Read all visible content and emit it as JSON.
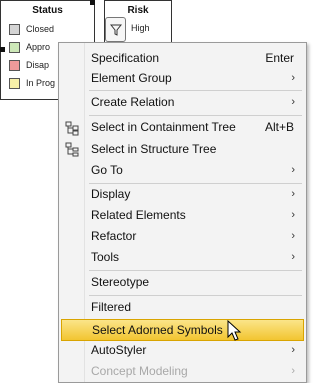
{
  "legend_status": {
    "title": "Status",
    "items": [
      {
        "label": "Closed",
        "color": "#d4d4d4"
      },
      {
        "label": "Appro",
        "color": "#cde8b8"
      },
      {
        "label": "Disap",
        "color": "#ee9a9a"
      },
      {
        "label": "In Prog",
        "color": "#f7f0a8"
      }
    ]
  },
  "legend_risk": {
    "title": "Risk",
    "item": "High",
    "filter_icon": "funnel-icon"
  },
  "menu": {
    "items": [
      {
        "id": "specification",
        "label": "Specification",
        "shortcut": "Enter"
      },
      {
        "id": "element-group",
        "label": "Element Group",
        "arrow": "›"
      },
      {
        "id": "create-relation",
        "label": "Create Relation",
        "arrow": "›"
      },
      {
        "id": "select-containment",
        "label": "Select in Containment Tree",
        "shortcut": "Alt+B",
        "icon": "containment-tree-icon"
      },
      {
        "id": "select-structure",
        "label": "Select in Structure Tree",
        "icon": "structure-tree-icon"
      },
      {
        "id": "go-to",
        "label": "Go To",
        "arrow": "›"
      },
      {
        "id": "display",
        "label": "Display",
        "arrow": "›"
      },
      {
        "id": "related-elements",
        "label": "Related Elements",
        "arrow": "›"
      },
      {
        "id": "refactor",
        "label": "Refactor",
        "arrow": "›"
      },
      {
        "id": "tools",
        "label": "Tools",
        "arrow": "›"
      },
      {
        "id": "stereotype",
        "label": "Stereotype"
      },
      {
        "id": "filtered",
        "label": "Filtered"
      },
      {
        "id": "select-adorned",
        "label": "Select Adorned Symbols",
        "highlighted": true
      },
      {
        "id": "autostyler",
        "label": "AutoStyler",
        "arrow": "›"
      },
      {
        "id": "concept-modeling",
        "label": "Concept Modeling",
        "arrow": "›",
        "disabled": true
      }
    ]
  },
  "colors": {
    "highlight_top": "#fbe58a",
    "highlight_bottom": "#f2c531",
    "menu_bg": "#f3f3f3"
  }
}
